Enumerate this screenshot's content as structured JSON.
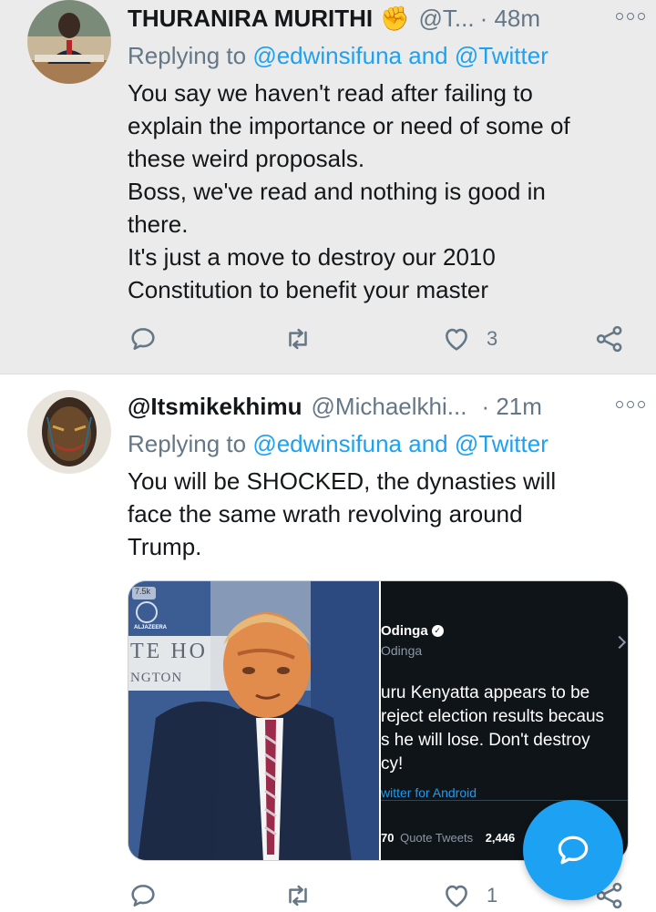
{
  "tweets": [
    {
      "name": "THURANIRA MURITHI",
      "emoji": "✊",
      "handle": "@T...",
      "time": "· 48m",
      "replying_prefix": "Replying to",
      "mentions": [
        "@edwinsifuna",
        "@Twitter"
      ],
      "mention_joiner": "and",
      "body": [
        "You say we haven't read after failing to",
        "explain the importance or need of some of",
        "these weird proposals.",
        "Boss, we've read and nothing is good in",
        "there.",
        "It's just a move to destroy our 2010",
        "Constitution to benefit your master"
      ],
      "like_count": "3"
    },
    {
      "name": "@Itsmikekhimu",
      "handle": "@Michaelkhi...",
      "time": "· 21m",
      "replying_prefix": "Replying to",
      "mentions": [
        "@edwinsifuna",
        "@Twitter"
      ],
      "mention_joiner": "and",
      "body": [
        "You will be SHOCKED, the dynasties will",
        "face the same wrath revolving around",
        "Trump."
      ],
      "like_count": "1",
      "media": {
        "left_image": {
          "badge": "7.5k",
          "logo_text": "ALJAZEERA",
          "background_text_1": "TE HO",
          "background_text_2": "NGTON"
        },
        "right_image": {
          "author": "Odinga",
          "handle": "Odinga",
          "text_lines": [
            "uru Kenyatta appears to be",
            "reject election results becaus",
            "s he will lose. Don't destroy",
            "cy!"
          ],
          "source": "witter for Android",
          "quote_tweets_count": "70",
          "quote_tweets_label": "Quote Tweets",
          "extra_count": "2,446"
        }
      }
    }
  ],
  "colors": {
    "accent": "#1da1f2",
    "secondary_text": "#657786",
    "highlight_bg": "#ebebeb"
  },
  "icons": {
    "reply": "reply-icon",
    "retweet": "retweet-icon",
    "like": "heart-icon",
    "share": "share-icon",
    "more": "more-icon",
    "compose": "compose-reply-icon"
  }
}
